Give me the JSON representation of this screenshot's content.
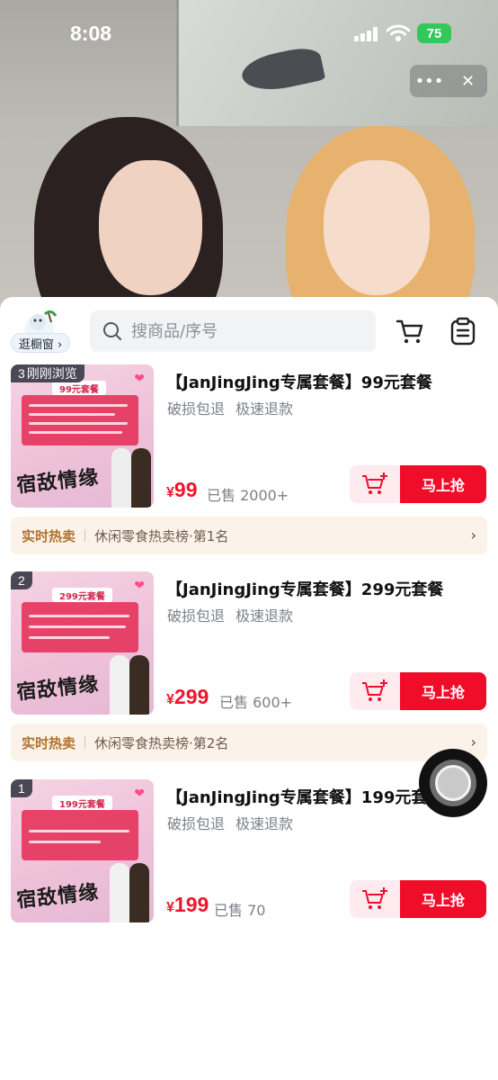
{
  "status_bar": {
    "time": "8:08",
    "battery": "75"
  },
  "storefront": {
    "label": "逛橱窗 ›"
  },
  "search": {
    "placeholder": "搜商品/序号"
  },
  "products": [
    {
      "badge_num": "3",
      "badge_text": "刚刚浏览",
      "pack_label": "99元套餐",
      "thumb_brand": "宿敌情缘",
      "title": "【JanJingJing专属套餐】99元套餐",
      "tags": [
        "破损包退",
        "极速退款"
      ],
      "price_symbol": "¥",
      "price": "99",
      "sold": "已售 2000+",
      "buy_label": "马上抢",
      "hot_label": "实时热卖",
      "hot_text": "休闲零食热卖榜·第1名"
    },
    {
      "badge_num": "2",
      "badge_text": "",
      "pack_label": "299元套餐",
      "thumb_brand": "宿敌情缘",
      "title": "【JanJingJing专属套餐】299元套餐",
      "tags": [
        "破损包退",
        "极速退款"
      ],
      "price_symbol": "¥",
      "price": "299",
      "sold": "已售 600+",
      "buy_label": "马上抢",
      "hot_label": "实时热卖",
      "hot_text": "休闲零食热卖榜·第2名"
    },
    {
      "badge_num": "1",
      "badge_text": "",
      "pack_label": "199元套餐",
      "thumb_brand": "宿敌情缘",
      "title": "【JanJingJing专属套餐】199元套",
      "tags": [
        "破损包退",
        "极速退款"
      ],
      "price_symbol": "¥",
      "price": "199",
      "sold": "已售 70",
      "buy_label": "马上抢"
    }
  ],
  "colors": {
    "price_red": "#f2132b",
    "buy_red": "#f00d2a",
    "hot_gold": "#b1722e"
  }
}
